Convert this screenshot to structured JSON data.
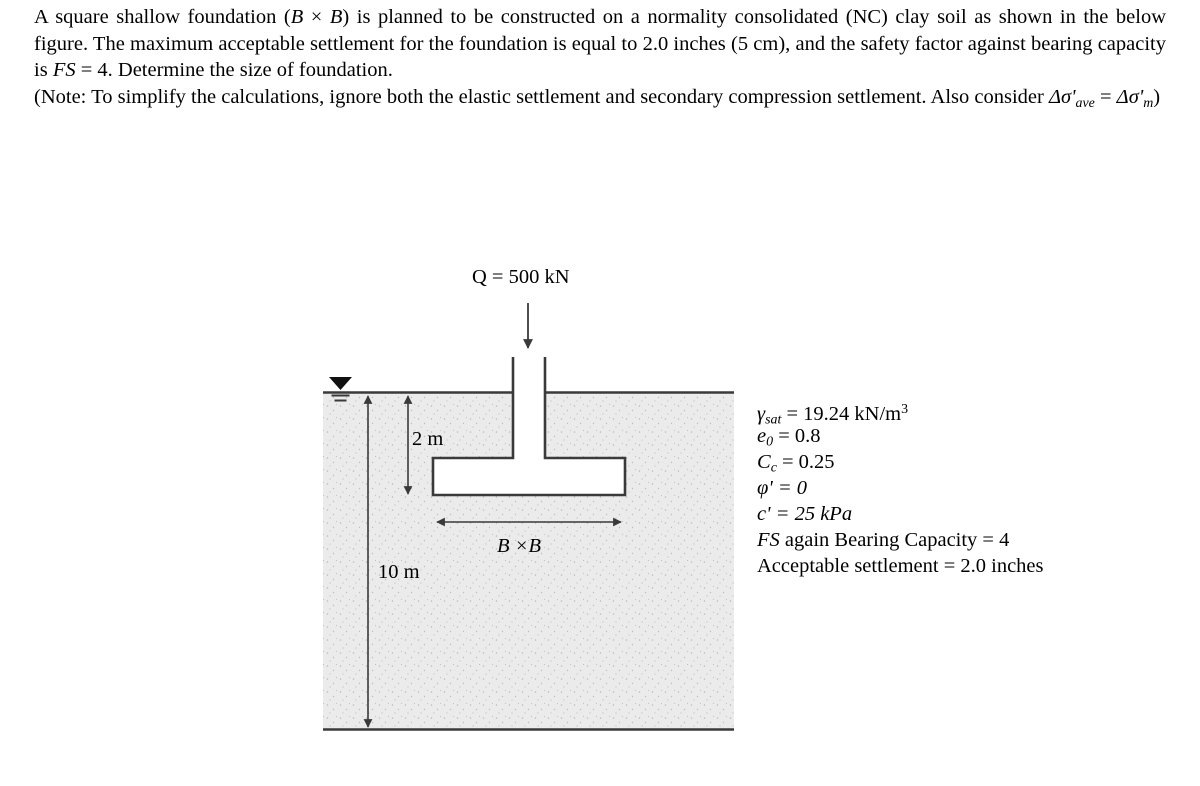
{
  "problem": {
    "paragraph_1_part_a": "A square shallow foundation (",
    "paragraph_1_B1": "B",
    "paragraph_1_times": " × ",
    "paragraph_1_B2": "B",
    "paragraph_1_part_b": ") is planned to be constructed on a normality consolidated (NC) clay soil as shown in the below figure. The maximum acceptable settlement for the foundation is equal to 2.0 inches (5 cm), and the safety factor against bearing capacity is ",
    "paragraph_1_FS": "FS",
    "paragraph_1_part_c": " = 4. Determine the size of foundation.",
    "note_part_a": "(Note: To simplify the calculations, ignore both the elastic settlement and secondary compression settlement. Also consider ",
    "note_delta1": "Δσ'",
    "note_sub1": "ave",
    "note_eq": " = ",
    "note_delta2": "Δσ'",
    "note_sub2": "m",
    "note_part_b": ")"
  },
  "figure": {
    "load_label": "Q = 500 kN",
    "depth_label": "2 m",
    "layer_thickness_label": "10 m",
    "footing_width_label": "B ×B",
    "colors": {
      "soil_fill": "#ebebeb",
      "line": "#3a3a3a",
      "footing_fill": "#ffffff",
      "text": "#000000"
    }
  },
  "soil_properties": [
    {
      "symbol": "γ",
      "sub": "sat",
      "sup": "",
      "value": " = 19.24 kN/m",
      "value_sup": "3"
    },
    {
      "symbol": "e",
      "sub": "0",
      "sup": "",
      "value": " = 0.8",
      "value_sup": ""
    },
    {
      "symbol": "C",
      "sub": "c",
      "sup": "",
      "value": " = 0.25",
      "value_sup": ""
    },
    {
      "symbol": "φ'",
      "sub": "",
      "sup": "",
      "value": " = 0",
      "value_sup": ""
    },
    {
      "symbol": "c'",
      "sub": "",
      "sup": "",
      "value": " = 25 kPa",
      "value_sup": ""
    },
    {
      "symbol": "FS",
      "sub": "",
      "sup": "",
      "value": " again Bearing Capacity = 4",
      "value_sup": ""
    },
    {
      "symbol": "",
      "sub": "",
      "sup": "",
      "value": "Acceptable settlement = 2.0 inches",
      "value_sup": ""
    }
  ],
  "soil_prop_lines": {
    "line_1_sym": "γ",
    "line_1_sub": "sat",
    "line_1_rest": " = 19.24 kN/m",
    "line_1_sup": "3",
    "line_2_sym": "e",
    "line_2_sub": "0",
    "line_2_rest": " = 0.8",
    "line_3_sym": "C",
    "line_3_sub": "c",
    "line_3_rest": " = 0.25",
    "line_4": "φ' = 0",
    "line_5": "c' = 25 kPa",
    "line_6_sym": "FS",
    "line_6_rest": " again Bearing Capacity = 4",
    "line_7": "Acceptable settlement = 2.0 inches"
  }
}
